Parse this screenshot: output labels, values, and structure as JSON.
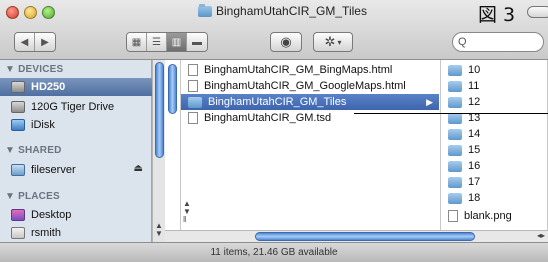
{
  "window": {
    "title": "BinghamUtahCIR_GM_Tiles",
    "figure_label": "図 3"
  },
  "toolbar": {
    "search_placeholder": "Q"
  },
  "sidebar": {
    "sections": [
      {
        "header": "▼ DEVICES"
      },
      {
        "header": "▼ SHARED"
      },
      {
        "header": "▼ PLACES"
      }
    ],
    "items": [
      {
        "label": "HD250",
        "icon": "hard-drive-icon",
        "selected": true
      },
      {
        "label": "120G Tiger Drive",
        "icon": "hard-drive-icon"
      },
      {
        "label": "iDisk",
        "icon": "idisk-icon"
      },
      {
        "label": "fileserver",
        "icon": "server-icon",
        "eject": "⏏"
      },
      {
        "label": "Desktop",
        "icon": "desktop-icon"
      },
      {
        "label": "rsmith",
        "icon": "home-icon"
      }
    ]
  },
  "column2": {
    "items": [
      {
        "label": "BinghamUtahCIR_GM_BingMaps.html",
        "icon": "document-icon"
      },
      {
        "label": "BinghamUtahCIR_GM_GoogleMaps.html",
        "icon": "document-icon"
      },
      {
        "label": "BinghamUtahCIR_GM_Tiles",
        "icon": "folder-icon",
        "selected": true
      },
      {
        "label": "BinghamUtahCIR_GM.tsd",
        "icon": "document-icon"
      }
    ]
  },
  "column3": {
    "items": [
      {
        "label": "10",
        "icon": "folder-icon"
      },
      {
        "label": "11",
        "icon": "folder-icon"
      },
      {
        "label": "12",
        "icon": "folder-icon"
      },
      {
        "label": "13",
        "icon": "folder-icon"
      },
      {
        "label": "14",
        "icon": "folder-icon"
      },
      {
        "label": "15",
        "icon": "folder-icon"
      },
      {
        "label": "16",
        "icon": "folder-icon"
      },
      {
        "label": "17",
        "icon": "folder-icon"
      },
      {
        "label": "18",
        "icon": "folder-icon"
      },
      {
        "label": "blank.png",
        "icon": "document-icon"
      }
    ]
  },
  "status": {
    "text": "11 items, 21.46 GB available"
  },
  "colors": {
    "selection": "#3d64ad",
    "sidebar_bg": "#dbe3ec",
    "folder": "#5f98cc"
  }
}
